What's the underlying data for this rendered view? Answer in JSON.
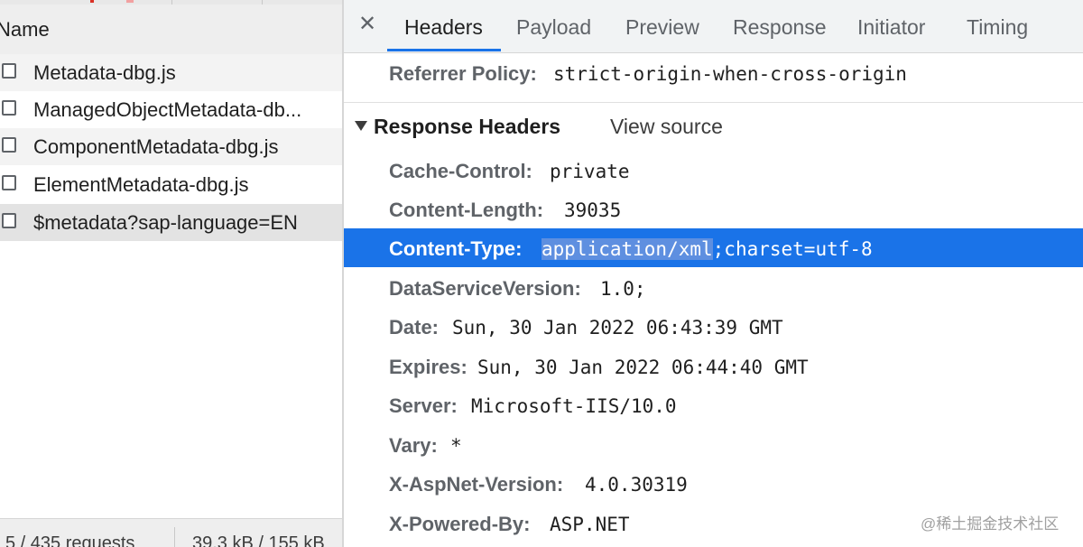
{
  "request_list": {
    "column_header": "Name",
    "rows": [
      {
        "name": "Metadata-dbg.js"
      },
      {
        "name": "ManagedObjectMetadata-dbg.js"
      },
      {
        "name": "ComponentMetadata-dbg.js"
      },
      {
        "name": "ElementMetadata-dbg.js"
      },
      {
        "name": "$metadata?sap-language=EN"
      }
    ],
    "status": {
      "requests": "5 / 435 requests",
      "transferred": "39.3 kB / 155 kB"
    }
  },
  "details": {
    "close_icon": "✕",
    "tabs": [
      {
        "label": "Headers",
        "active": true
      },
      {
        "label": "Payload",
        "active": false
      },
      {
        "label": "Preview",
        "active": false
      },
      {
        "label": "Response",
        "active": false
      },
      {
        "label": "Initiator",
        "active": false
      },
      {
        "label": "Timing",
        "active": false
      }
    ],
    "referrer_policy": {
      "key": "Referrer Policy:",
      "value": "strict-origin-when-cross-origin"
    },
    "response_headers": {
      "title": "Response Headers",
      "view_source": "View source",
      "toggle_icon": "triangle-down-icon",
      "headers": [
        {
          "key": "Cache-Control:",
          "value": "private"
        },
        {
          "key": "Content-Length:",
          "value": "39035"
        },
        {
          "key": "Content-Type:",
          "value_selected": "application/xml",
          "value_rest": ";charset=utf-8"
        },
        {
          "key": "DataServiceVersion:",
          "value": "1.0;"
        },
        {
          "key": "Date:",
          "value": "Sun, 30 Jan 2022 06:43:39 GMT"
        },
        {
          "key": "Expires:",
          "value": "Sun, 30 Jan 2022 06:44:40 GMT"
        },
        {
          "key": "Server:",
          "value": "Microsoft-IIS/10.0"
        },
        {
          "key": "Vary:",
          "value": "*"
        },
        {
          "key": "X-AspNet-Version:",
          "value": "4.0.30319"
        },
        {
          "key": "X-Powered-By:",
          "value": "ASP.NET"
        }
      ]
    }
  },
  "watermark": "@稀土掘金技术社区",
  "colors": {
    "accent": "#1a73e8",
    "selection": "#5e8fe0"
  }
}
